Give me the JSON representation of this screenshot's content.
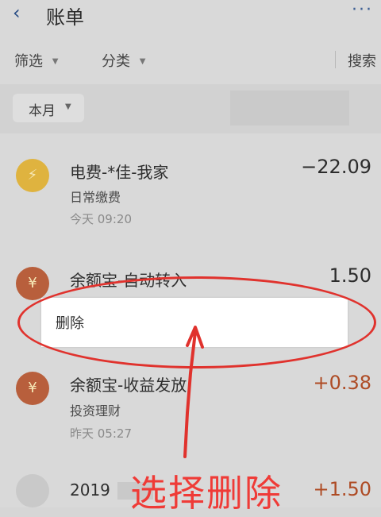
{
  "header": {
    "back_icon": "back-chevron-icon",
    "title": "账单",
    "more_icon": "more-dots-icon"
  },
  "filters": {
    "filter": "筛选",
    "category": "分类",
    "search": "搜索",
    "arrow_icon": "dropdown-triangle-icon"
  },
  "month": {
    "label": "本月",
    "arrow_icon": "dropdown-triangle-icon"
  },
  "transactions": [
    {
      "title": "电费-*佳-我家",
      "category": "日常缴费",
      "time": "今天  09:20",
      "amount": "−22.09",
      "icon": "lightning-icon"
    },
    {
      "title": "余额宝-自动转入",
      "amount": "1.50",
      "icon": "money-bag-icon"
    },
    {
      "title": "余额宝-收益发放",
      "category": "投资理财",
      "time": "昨天  05:27",
      "amount": "+0.38",
      "icon": "money-bag-icon"
    },
    {
      "title": "2019",
      "amount": "+1.50"
    }
  ],
  "popup": {
    "delete_label": "删除"
  },
  "annotation": {
    "text": "选择删除",
    "color": "#e0322d"
  }
}
